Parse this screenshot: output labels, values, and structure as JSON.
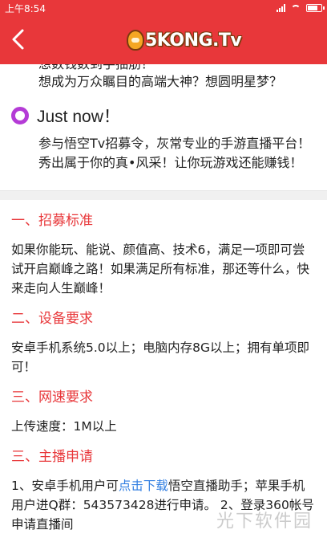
{
  "status_bar": {
    "time": "上午8:54"
  },
  "app_bar": {
    "logo_text": "5KONG.Tv"
  },
  "intro": {
    "cut_line": "想数钱数到手抽筋？",
    "line2": "想成为万众瞩目的高端大神？想圆明星梦？"
  },
  "just_now": {
    "title": "Just now！",
    "text": "参与悟空Tv招募令，灰常专业的手游直播平台！秀出属于你的真•风采！让你玩游戏还能赚钱！"
  },
  "sections": [
    {
      "title": "一、招募标准",
      "body": "如果你能玩、能说、颜值高、技术6，满足一项即可尝试开启巅峰之路！如果满足所有标准，那还等什么，快来走向人生巅峰！"
    },
    {
      "title": "二、设备要求",
      "body": "安卓手机系统5.0以上；电脑内存8G以上；拥有单项即可！"
    },
    {
      "title": "三、网速要求",
      "body": "上传速度：1M以上"
    },
    {
      "title": "三、主播申请",
      "body_pre": "1、安卓手机用户可",
      "link": "点击下载",
      "body_post": "悟空直播助手；苹果手机用户进Q群：543573428进行申请。 2、登录360帐号申请直播间"
    }
  ],
  "watermark": "光下软件园"
}
